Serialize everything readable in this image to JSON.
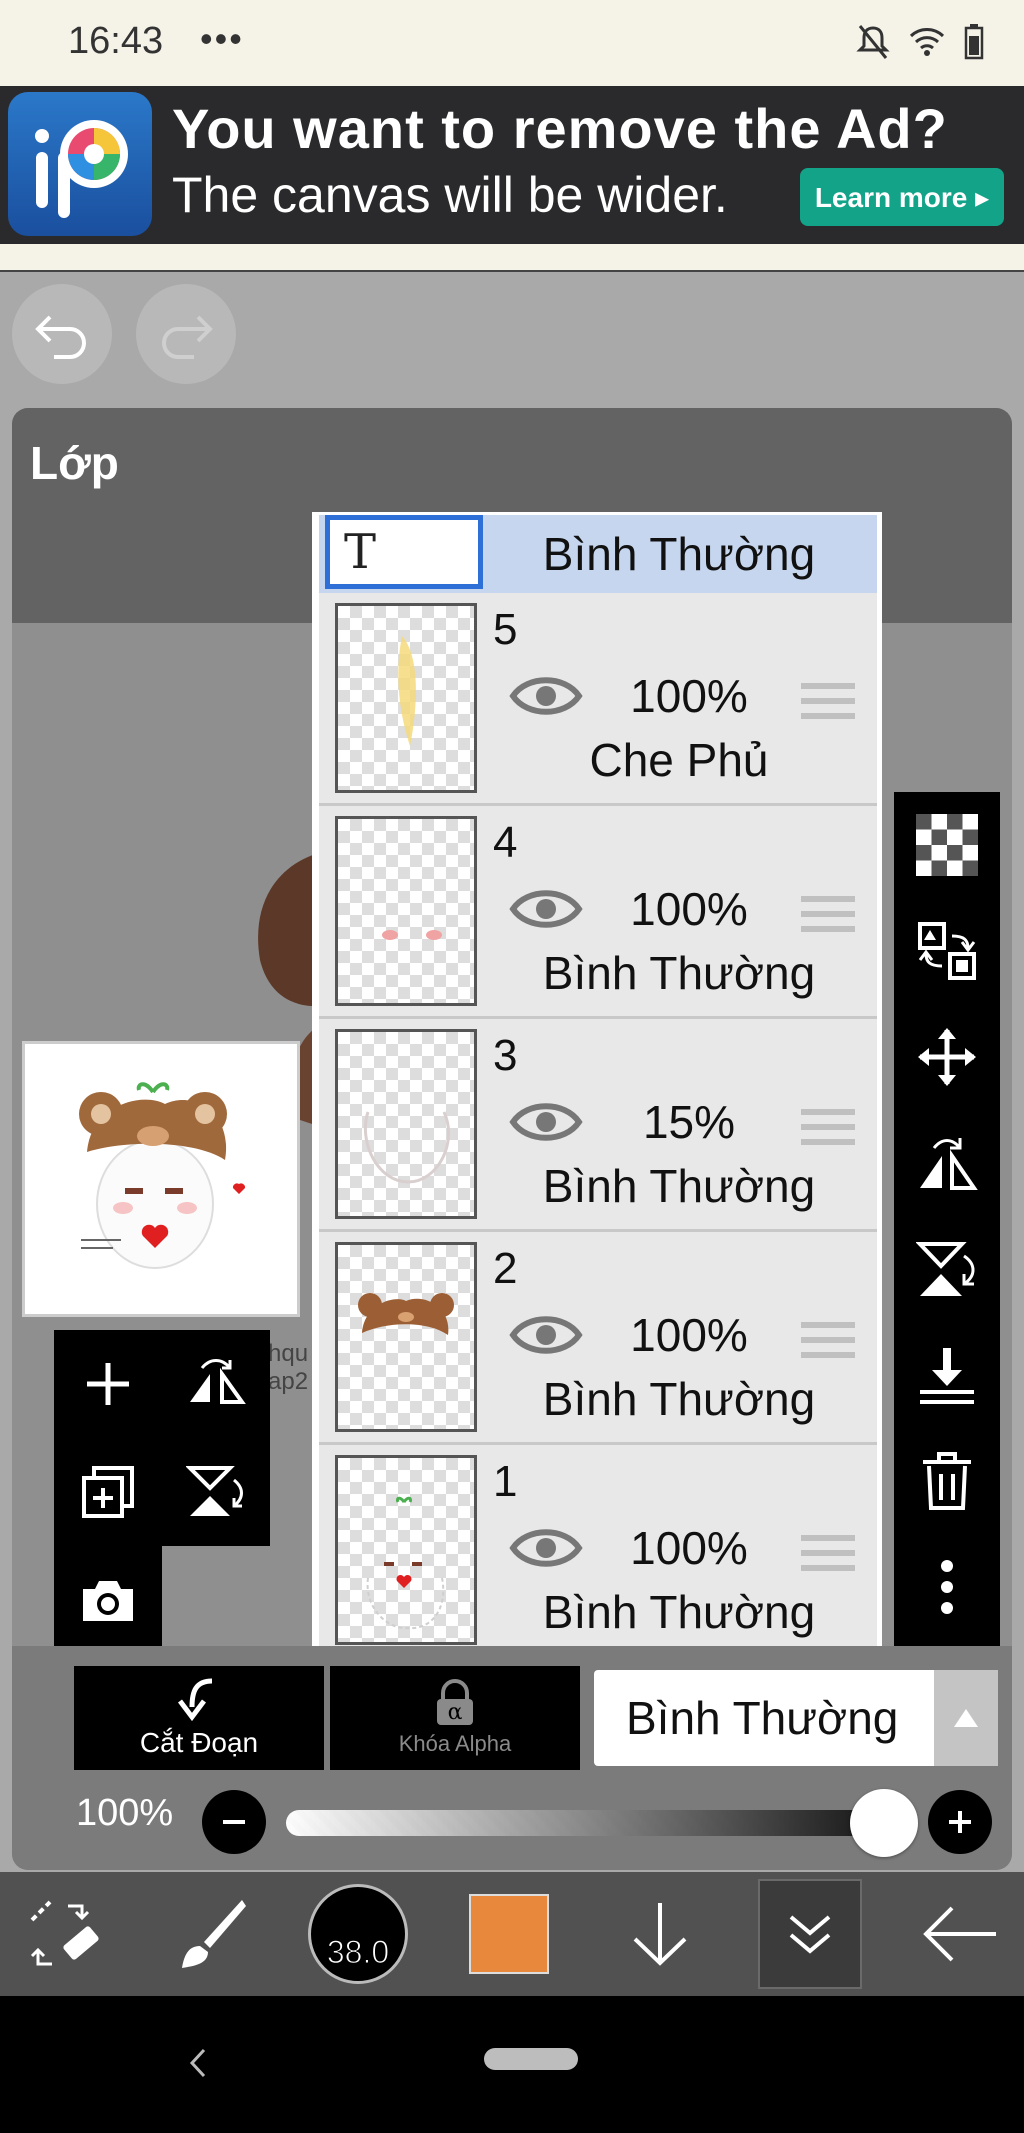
{
  "status": {
    "time": "16:43",
    "dots": "•••"
  },
  "ad": {
    "headline": "You want to remove the Ad?",
    "subline": "The canvas will be wider.",
    "learn_more": "Learn more ▸"
  },
  "panel": {
    "title": "Lớp"
  },
  "layers": {
    "top": {
      "mode": "Bình Thường"
    },
    "rows": [
      {
        "num": "5",
        "opacity": "100%",
        "mode": "Che Phủ"
      },
      {
        "num": "4",
        "opacity": "100%",
        "mode": "Bình Thường"
      },
      {
        "num": "3",
        "opacity": "15%",
        "mode": "Bình Thường"
      },
      {
        "num": "2",
        "opacity": "100%",
        "mode": "Bình Thường"
      },
      {
        "num": "1",
        "opacity": "100%",
        "mode": "Bình Thường"
      }
    ]
  },
  "controls": {
    "clip_label": "Cắt Đoạn",
    "alpha_label": "Khóa Alpha",
    "blend_mode": "Bình Thường",
    "opacity_label": "100%",
    "opacity_value": 1.0
  },
  "toolbar": {
    "brush_size": "38.0",
    "color": "#e8883c"
  },
  "colors": {
    "accent": "#13a389",
    "selection": "#c5d6ee"
  }
}
